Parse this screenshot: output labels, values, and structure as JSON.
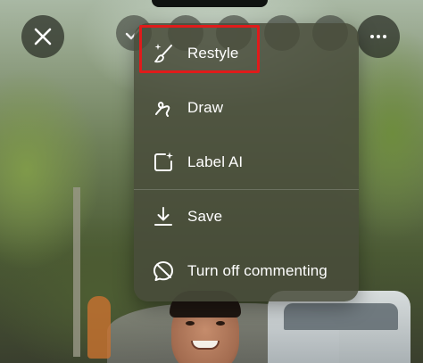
{
  "menu": {
    "items": [
      {
        "label": "Restyle",
        "icon": "paintbrush-sparkle-icon"
      },
      {
        "label": "Draw",
        "icon": "squiggle-pen-icon"
      },
      {
        "label": "Label AI",
        "icon": "sparkle-square-icon"
      },
      {
        "label": "Save",
        "icon": "download-icon"
      },
      {
        "label": "Turn off commenting",
        "icon": "comment-off-icon"
      }
    ]
  },
  "colors": {
    "highlight": "#e01b1b",
    "menu_bg": "#484c3a",
    "text": "#ffffff"
  }
}
